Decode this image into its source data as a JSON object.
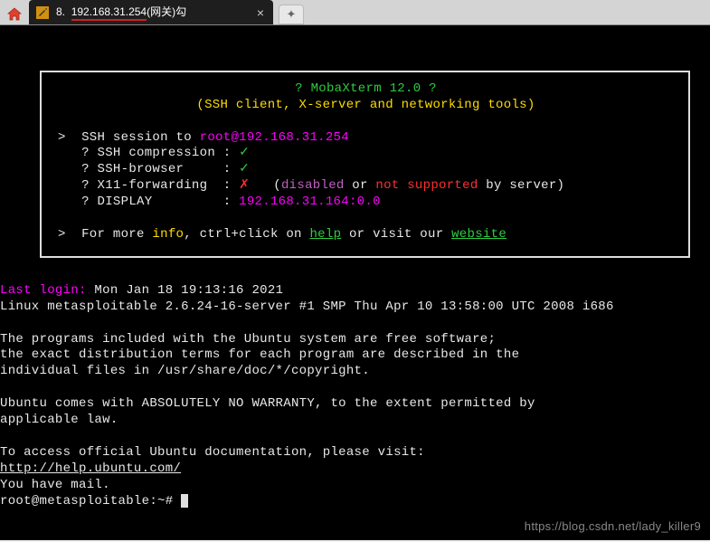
{
  "tab": {
    "number": "8.",
    "ip": "192.168.31.254",
    "suffix": "(网关)勾"
  },
  "banner": {
    "line1_q": "? ",
    "line1_app": "MobaXterm 12.0",
    "line1_q2": " ?",
    "line2": "(SSH client, X-server and networking tools)",
    "ssh_prefix": ">  SSH session to ",
    "ssh_user": "root",
    "ssh_at": "@",
    "ssh_host": "192.168.31.254",
    "row_compress": "? SSH compression : ",
    "row_browser": "? SSH-browser     : ",
    "row_x11": "? X11-forwarding  : ",
    "row_x11_open": "   (",
    "row_x11_disabled": "disabled",
    "row_x11_or": " or ",
    "row_x11_ns": "not supported",
    "row_x11_by": " by server)",
    "row_disp": "? DISPLAY         : ",
    "row_disp_val": "192.168.31.164:0.0",
    "more_prefix": ">  For more ",
    "more_info": "info",
    "more_mid1": ", ctrl+click on ",
    "more_help": "help",
    "more_mid2": " or visit our ",
    "more_site": "website"
  },
  "body": {
    "last_login_label": "Last login:",
    "last_login_val": " Mon Jan 18 19:13:16 2021",
    "uname": "Linux metasploitable 2.6.24-16-server #1 SMP Thu Apr 10 13:58:00 UTC 2008 i686",
    "para1_l1": "The programs included with the Ubuntu system are free software;",
    "para1_l2": "the exact distribution terms for each program are described in the",
    "para1_l3": "individual files in /usr/share/doc/*/copyright.",
    "para2_l1": "Ubuntu comes with ABSOLUTELY NO WARRANTY, to the extent permitted by",
    "para2_l2": "applicable law.",
    "para3_l1": "To access official Ubuntu documentation, please visit:",
    "para3_l2": "http://help.ubuntu.com/",
    "mail": "You have mail.",
    "prompt": "root@metasploitable:~# "
  },
  "watermark": "https://blog.csdn.net/lady_killer9"
}
